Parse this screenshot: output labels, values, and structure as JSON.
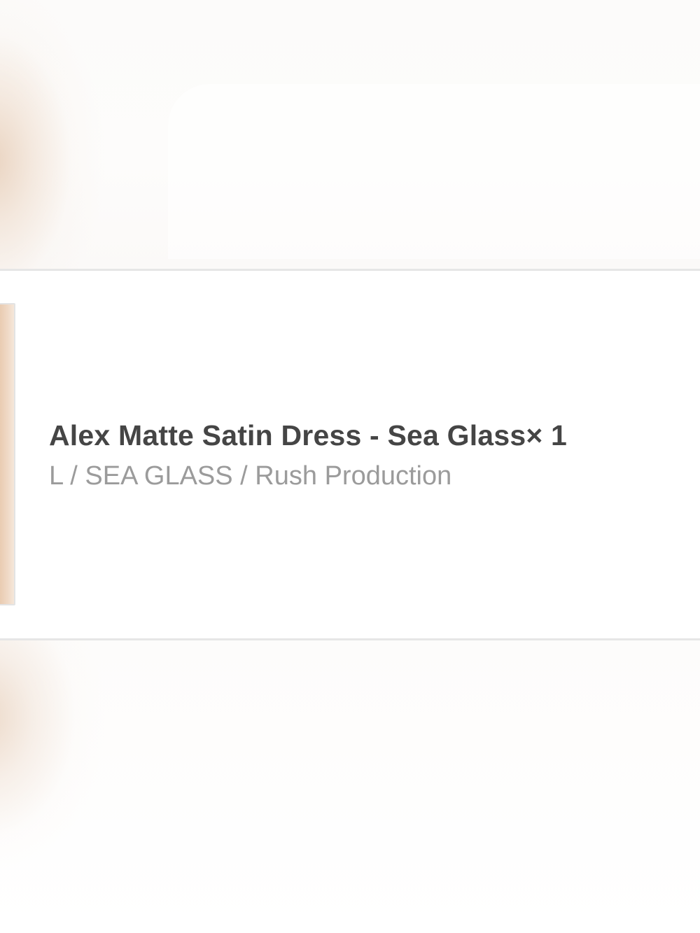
{
  "line_item": {
    "title": "Alex Matte Satin Dress - Sea Glass× 1",
    "variant": "L / SEA GLASS / Rush Production"
  },
  "colors": {
    "title_text": "#454545",
    "variant_text": "#9b9b9b",
    "divider": "#e6e6e6",
    "thumbnail_tone": "#e8c9ad"
  }
}
